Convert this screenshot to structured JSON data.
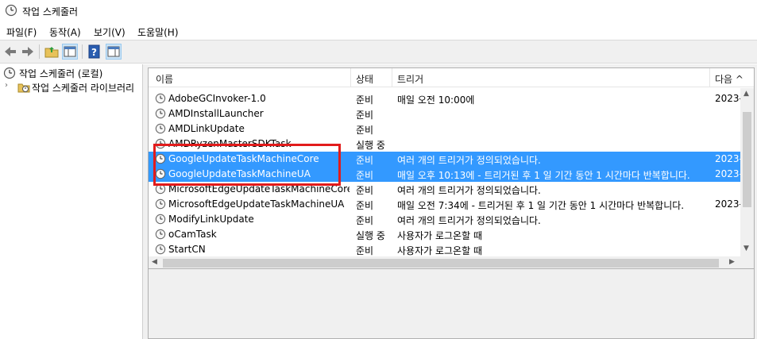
{
  "window": {
    "title": "작업 스케줄러"
  },
  "menu": [
    {
      "label": "파일(F)"
    },
    {
      "label": "동작(A)"
    },
    {
      "label": "보기(V)"
    },
    {
      "label": "도움말(H)"
    }
  ],
  "tree": {
    "root": "작업 스케줄러 (로컬)",
    "library": "작업 스케줄러 라이브러리"
  },
  "columns": {
    "name": "이름",
    "status": "상태",
    "triggers": "트리거",
    "next": "다음 ^"
  },
  "tasks": [
    {
      "name": "AdobeGCInvoker-1.0",
      "status": "준비",
      "trigger": "매일 오전 10:00에",
      "next": "2023-"
    },
    {
      "name": "AMDInstallLauncher",
      "status": "준비",
      "trigger": "",
      "next": ""
    },
    {
      "name": "AMDLinkUpdate",
      "status": "준비",
      "trigger": "",
      "next": ""
    },
    {
      "name": "AMDRyzenMasterSDKTask",
      "status": "실행 중",
      "trigger": "",
      "next": ""
    },
    {
      "name": "GoogleUpdateTaskMachineCore",
      "status": "준비",
      "trigger": "여러 개의 트리거가 정의되었습니다.",
      "next": "2023-"
    },
    {
      "name": "GoogleUpdateTaskMachineUA",
      "status": "준비",
      "trigger": "매일 오후 10:13에 - 트리거된 후 1 일 기간 동안 1 시간마다 반복합니다.",
      "next": "2023-"
    },
    {
      "name": "MicrosoftEdgeUpdateTaskMachineCore",
      "status": "준비",
      "trigger": "여러 개의 트리거가 정의되었습니다.",
      "next": ""
    },
    {
      "name": "MicrosoftEdgeUpdateTaskMachineUA",
      "status": "준비",
      "trigger": "매일 오전 7:34에 - 트리거된 후 1 일 기간 동안 1 시간마다 반복합니다.",
      "next": "2023-"
    },
    {
      "name": "ModifyLinkUpdate",
      "status": "준비",
      "trigger": "여러 개의 트리거가 정의되었습니다.",
      "next": ""
    },
    {
      "name": "oCamTask",
      "status": "실행 중",
      "trigger": "사용자가 로그온할 때",
      "next": ""
    },
    {
      "name": "StartCN",
      "status": "준비",
      "trigger": "사용자가 로그온할 때",
      "next": ""
    }
  ],
  "colors": {
    "selection": "#3399ff",
    "highlight_box": "#e21b1b"
  }
}
